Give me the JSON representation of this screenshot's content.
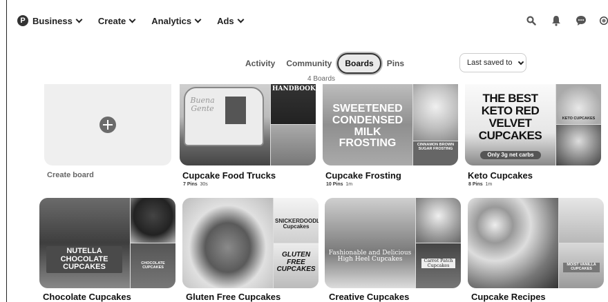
{
  "nav": {
    "logo": "P",
    "items": [
      {
        "label": "Business"
      },
      {
        "label": "Create"
      },
      {
        "label": "Analytics"
      },
      {
        "label": "Ads"
      }
    ]
  },
  "tabs": [
    {
      "label": "Activity"
    },
    {
      "label": "Community"
    },
    {
      "label": "Boards"
    },
    {
      "label": "Pins"
    }
  ],
  "boards_count": "4 Boards",
  "sort": {
    "label": "Last saved to"
  },
  "create_board": {
    "label": "Create board"
  },
  "boards": [
    {
      "title": "Cupcake Food Trucks",
      "pins": "7 Pins",
      "time": "30s",
      "img_main": "Buena Gente",
      "img_side": "HANDBOOK"
    },
    {
      "title": "Cupcake Frosting",
      "pins": "10 Pins",
      "time": "1m",
      "img_main": "SWEETENED CONDENSED MILK FROSTING",
      "img_side": "CINNAMON BROWN SUGAR FROSTING"
    },
    {
      "title": "Keto Cupcakes",
      "pins": "8 Pins",
      "time": "1m",
      "img_main": "THE BEST KETO RED VELVET CUPCAKES",
      "img_note": "Only 3g net carbs",
      "img_side": "KETO CUPCAKES"
    },
    {
      "title": "Chocolate Cupcakes",
      "img_main": "NUTELLA CHOCOLATE CUPCAKES",
      "img_side": "CHOCOLATE CUPCAKES"
    },
    {
      "title": "Gluten Free Cupcakes",
      "img_side": "SNICKERDOODLE Cupcakes",
      "img_side2": "GLUTEN FREE CUPCAKES"
    },
    {
      "title": "Creative Cupcakes",
      "img_main": "Fashionable and Delicious High Heel Cupcakes",
      "img_side": "Carrot Patch Cupcakes"
    },
    {
      "title": "Cupcake Recipes",
      "img_side": "MOIST VANILLA CUPCAKES"
    }
  ]
}
